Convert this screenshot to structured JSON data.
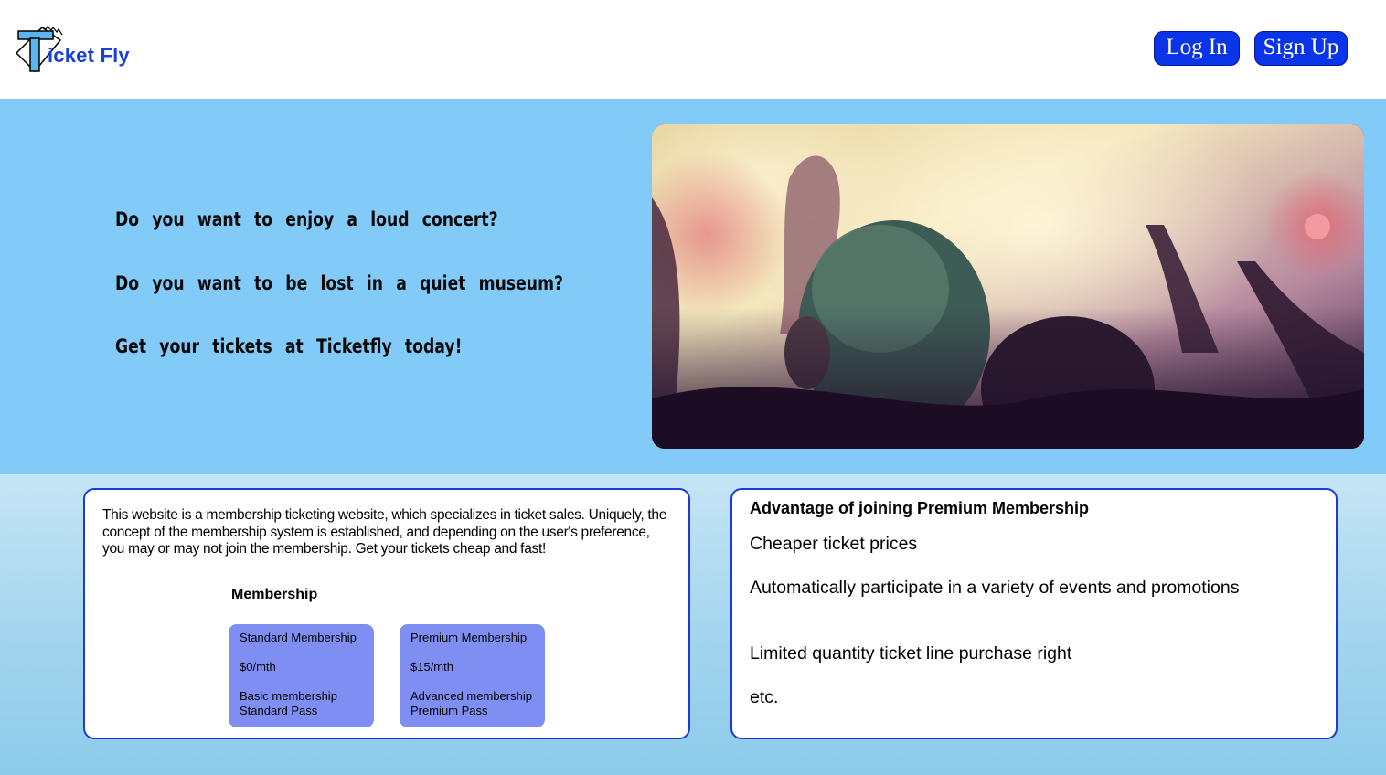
{
  "header": {
    "logo_text": "icket Fly",
    "login_label": "Log In",
    "signup_label": "Sign Up"
  },
  "hero": {
    "lines": [
      "Do you want to enjoy a loud concert?",
      "Do you want to be lost in a quiet museum?",
      "Get your tickets at Ticketfly today!"
    ],
    "image": "concert-crowd-photo"
  },
  "about": {
    "intro": "This website is a membership ticketing website, which specializes in ticket sales. Uniquely, the concept of the membership system is established, and depending on the user's preference, you may or may not join the membership. Get your tickets cheap and fast!",
    "membership_title": "Membership",
    "plans": [
      {
        "name": "Standard Membership",
        "price": "$0/mth",
        "line1": "Basic membership",
        "line2": "Standard Pass"
      },
      {
        "name": "Premium Membership",
        "price": "$15/mth",
        "line1": "Advanced membership",
        "line2": "Premium Pass"
      }
    ]
  },
  "advantages": {
    "title": "Advantage of joining Premium Membership",
    "items": [
      "Cheaper ticket prices",
      "Automatically participate in a variety of events and promotions",
      "Limited quantity ticket line purchase right",
      "etc."
    ]
  },
  "colors": {
    "brand_blue": "#0a34e8",
    "hero_bg": "#82caf8",
    "plan_card": "#7f8ef2",
    "card_border": "#1b3ad8"
  }
}
